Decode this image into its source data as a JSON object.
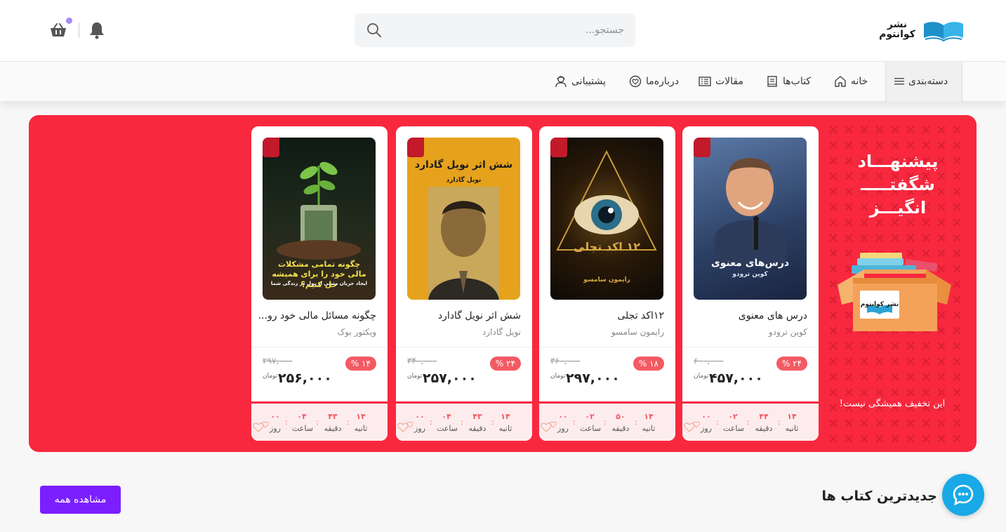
{
  "header": {
    "logo_text": "نشر کوانتوم",
    "search_placeholder": "جستجو...",
    "search_icon": "search-icon",
    "bell_icon": "bell-icon",
    "basket_icon": "basket-icon"
  },
  "nav": {
    "category": "دسته‌بندی",
    "items": [
      {
        "label": "خانه",
        "icon": "home-icon"
      },
      {
        "label": "کتاب‌ها",
        "icon": "book-icon"
      },
      {
        "label": "مقالات",
        "icon": "article-icon"
      },
      {
        "label": "درباره‌ما",
        "icon": "heart-badge-icon"
      },
      {
        "label": "پشتیبانی",
        "icon": "support-icon"
      }
    ]
  },
  "offer": {
    "title_line1": "پیشنهـــاد",
    "title_line2": "شگفتـــــ",
    "title_line3": "انگیـــز",
    "note": "این تخفیف همیشگی نیست!",
    "box_label": "نشر کوانتوم",
    "colors": {
      "background": "#f8283f",
      "discount": "#f35a63"
    },
    "products": [
      {
        "title": "درس های معنوی",
        "author": "کوین ترودو",
        "cover_title": "درس‌های معنوی",
        "cover_sub": "کوین ترودو",
        "discount": "۲۴ %",
        "old_price": "۶۰۰,۰۰۰",
        "price": "۴۵۷,۰۰۰",
        "currency": "تومان",
        "timer": {
          "seconds": "۱۴",
          "minutes": "۴۴",
          "hours": "۰۲",
          "days": "۰۰"
        }
      },
      {
        "title": "۱۲اکد تجلی",
        "author": "رایمون سامسو",
        "cover_title": "۱۲ اکد تجلی",
        "cover_sub": "رایمون سامسو",
        "discount": "۱۸ %",
        "old_price": "۳۶۰,۰۰۰",
        "price": "۲۹۷,۰۰۰",
        "currency": "تومان",
        "timer": {
          "seconds": "۱۴",
          "minutes": "۵۰",
          "hours": "۰۲",
          "days": "۰۰"
        }
      },
      {
        "title": "شش اثر نویل گادارد",
        "author": "نویل گادارد",
        "cover_title": "شش اثر نویل گادارد",
        "cover_sub": "نویل گادارد",
        "discount": "۲۴ %",
        "old_price": "۳۴۰,۰۰۰",
        "price": "۲۵۷,۰۰۰",
        "currency": "تومان",
        "timer": {
          "seconds": "۱۴",
          "minutes": "۴۳",
          "hours": "۰۴",
          "days": "۰۰"
        }
      },
      {
        "title": "چگونه مسائل مالی خود رو...",
        "author": "ویکتور بوک",
        "cover_title": "چگونه تمامی مشکلات مالی خود را برای همیشه حل کنیم؟",
        "cover_sub": "ایجاد جریان مثبتی از پول در زندگی شما",
        "discount": "۱۴ %",
        "old_price": "۲۹۷,۰۰۰",
        "price": "۲۵۶,۰۰۰",
        "currency": "تومان",
        "timer": {
          "seconds": "۱۴",
          "minutes": "۴۳",
          "hours": "۰۴",
          "days": "۰۰"
        }
      }
    ],
    "timer_labels": {
      "seconds": "ثانیه",
      "minutes": "دقیقه",
      "hours": "ساعت",
      "days": "روز"
    }
  },
  "newest": {
    "title": "جدیدترین کتاب ها",
    "view_all": "مشاهده همه"
  },
  "chat_icon": "chat-icon"
}
